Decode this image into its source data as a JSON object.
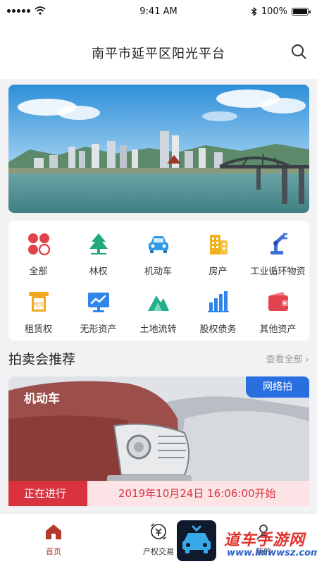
{
  "status_bar": {
    "time": "9:41 AM",
    "battery": "100%"
  },
  "header": {
    "title": "南平市延平区阳光平台"
  },
  "categories": [
    {
      "label": "全部",
      "icon": "clover-icon"
    },
    {
      "label": "林权",
      "icon": "tree-icon"
    },
    {
      "label": "机动车",
      "icon": "car-icon"
    },
    {
      "label": "房产",
      "icon": "building-icon"
    },
    {
      "label": "工业循环物资",
      "icon": "robot-arm-icon"
    },
    {
      "label": "租赁权",
      "icon": "lease-scroll-icon"
    },
    {
      "label": "无形资产",
      "icon": "monitor-chart-icon"
    },
    {
      "label": "土地流转",
      "icon": "mountain-icon"
    },
    {
      "label": "股权债务",
      "icon": "bar-chart-icon"
    },
    {
      "label": "其他资产",
      "icon": "wallet-icon"
    }
  ],
  "lease_icon_text": "租赁",
  "section": {
    "title": "拍卖会推荐",
    "more": "查看全部 ›"
  },
  "auction": {
    "category": "机动车",
    "tag": "网络拍",
    "status": "正在进行",
    "start_time": "2019年10月24日   16:06:00开始"
  },
  "tabbar": {
    "home": "首页",
    "trade": "产权交易",
    "mine": "我的"
  },
  "watermark": {
    "main": "道车手游网",
    "sub": "www.lmwwsz.com"
  },
  "colors": {
    "accent": "#b63a2c",
    "status_red": "#d9333f",
    "tag_blue": "#2a6fe0"
  }
}
